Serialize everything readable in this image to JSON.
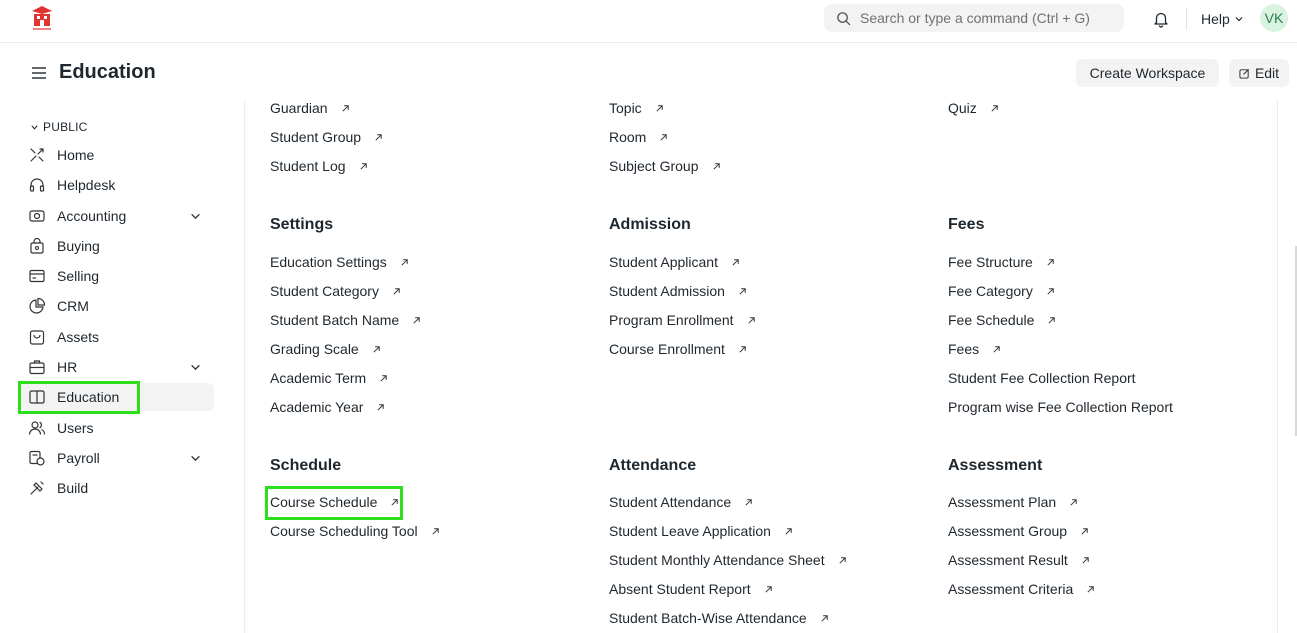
{
  "navbar": {
    "search_placeholder": "Search or type a command (Ctrl + G)",
    "help_label": "Help",
    "avatar_initials": "VK"
  },
  "header": {
    "title": "Education",
    "create_workspace_label": "Create Workspace",
    "edit_label": "Edit"
  },
  "sidebar": {
    "section_label": "PUBLIC",
    "items": [
      {
        "label": "Home",
        "icon": "home-icon"
      },
      {
        "label": "Helpdesk",
        "icon": "headset-icon"
      },
      {
        "label": "Accounting",
        "icon": "accounting-icon",
        "expandable": true
      },
      {
        "label": "Buying",
        "icon": "shopping-bag-icon"
      },
      {
        "label": "Selling",
        "icon": "selling-icon"
      },
      {
        "label": "CRM",
        "icon": "crm-chart-icon"
      },
      {
        "label": "Assets",
        "icon": "assets-box-icon"
      },
      {
        "label": "HR",
        "icon": "briefcase-icon",
        "expandable": true
      },
      {
        "label": "Education",
        "icon": "book-icon",
        "active": true
      },
      {
        "label": "Users",
        "icon": "users-icon"
      },
      {
        "label": "Payroll",
        "icon": "payroll-icon",
        "expandable": true
      },
      {
        "label": "Build",
        "icon": "tools-icon"
      }
    ]
  },
  "cards": {
    "top_col1": [
      "Guardian",
      "Student Group",
      "Student Log"
    ],
    "top_col2": [
      "Topic",
      "Room",
      "Subject Group"
    ],
    "top_col3": [
      "Quiz"
    ],
    "settings": {
      "title": "Settings",
      "links": [
        "Education Settings",
        "Student Category",
        "Student Batch Name",
        "Grading Scale",
        "Academic Term",
        "Academic Year"
      ]
    },
    "admission": {
      "title": "Admission",
      "links": [
        "Student Applicant",
        "Student Admission",
        "Program Enrollment",
        "Course Enrollment"
      ]
    },
    "fees": {
      "title": "Fees",
      "links": [
        "Fee Structure",
        "Fee Category",
        "Fee Schedule",
        "Fees"
      ],
      "reports": [
        "Student Fee Collection Report",
        "Program wise Fee Collection Report"
      ]
    },
    "schedule": {
      "title": "Schedule",
      "links": [
        "Course Schedule",
        "Course Scheduling Tool"
      ]
    },
    "attendance": {
      "title": "Attendance",
      "links": [
        "Student Attendance",
        "Student Leave Application",
        "Student Monthly Attendance Sheet",
        "Absent Student Report",
        "Student Batch-Wise Attendance"
      ]
    },
    "assessment": {
      "title": "Assessment",
      "links": [
        "Assessment Plan",
        "Assessment Group",
        "Assessment Result",
        "Assessment Criteria"
      ]
    }
  },
  "colors": {
    "highlight": "#2ee01b",
    "active_bg": "#f3f3f3",
    "text": "#1f272e",
    "avatar_bg": "#d8f3e0",
    "logo_red": "#e0342f"
  }
}
